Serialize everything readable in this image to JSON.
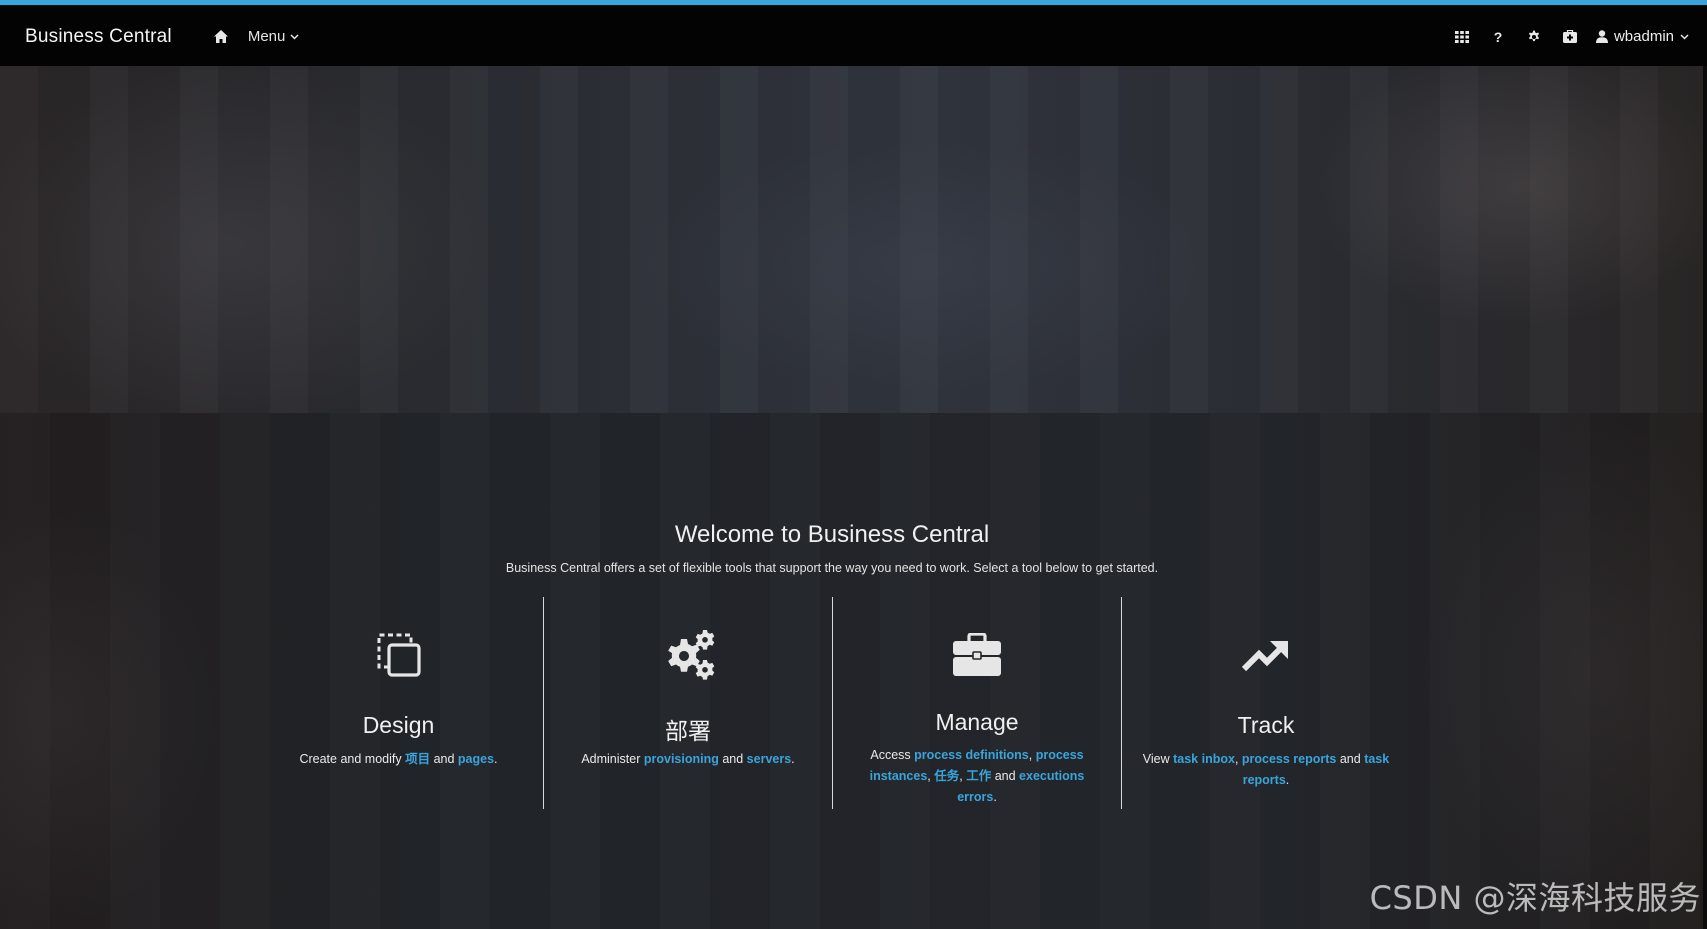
{
  "navbar": {
    "brand": "Business Central",
    "menu_label": "Menu",
    "help_label": "?",
    "user_label": "wbadmin"
  },
  "welcome": {
    "title": "Welcome to Business Central",
    "subtitle": "Business Central offers a set of flexible tools that support the way you need to work. Select a tool below to get started."
  },
  "tiles": {
    "design": {
      "title": "Design",
      "desc_pre": "Create and modify ",
      "link_projects": "项目",
      "and1": " and ",
      "link_pages": "pages",
      "end": "."
    },
    "deploy": {
      "title": "部署",
      "desc_pre": "Administer ",
      "link_provisioning": "provisioning",
      "and1": " and ",
      "link_servers": "servers",
      "end": "."
    },
    "manage": {
      "title": "Manage",
      "desc_pre": "Access ",
      "link_process_definitions": "process definitions",
      "sep1": ", ",
      "link_process_instances": "process instances",
      "sep2": ", ",
      "link_tasks": "任务",
      "sep3": ", ",
      "link_jobs": "工作",
      "and1": " and ",
      "link_execution_errors": "executions errors",
      "end": "."
    },
    "track": {
      "title": "Track",
      "desc_pre": "View ",
      "link_task_inbox": "task inbox",
      "sep1": ", ",
      "link_process_reports": "process reports",
      "and1": " and ",
      "link_task_reports": "task reports",
      "end": "."
    }
  },
  "watermark": "CSDN @深海科技服务",
  "colors": {
    "accent": "#39a5dc",
    "navbar_bg": "#030303",
    "page_bg": "#23262b"
  }
}
